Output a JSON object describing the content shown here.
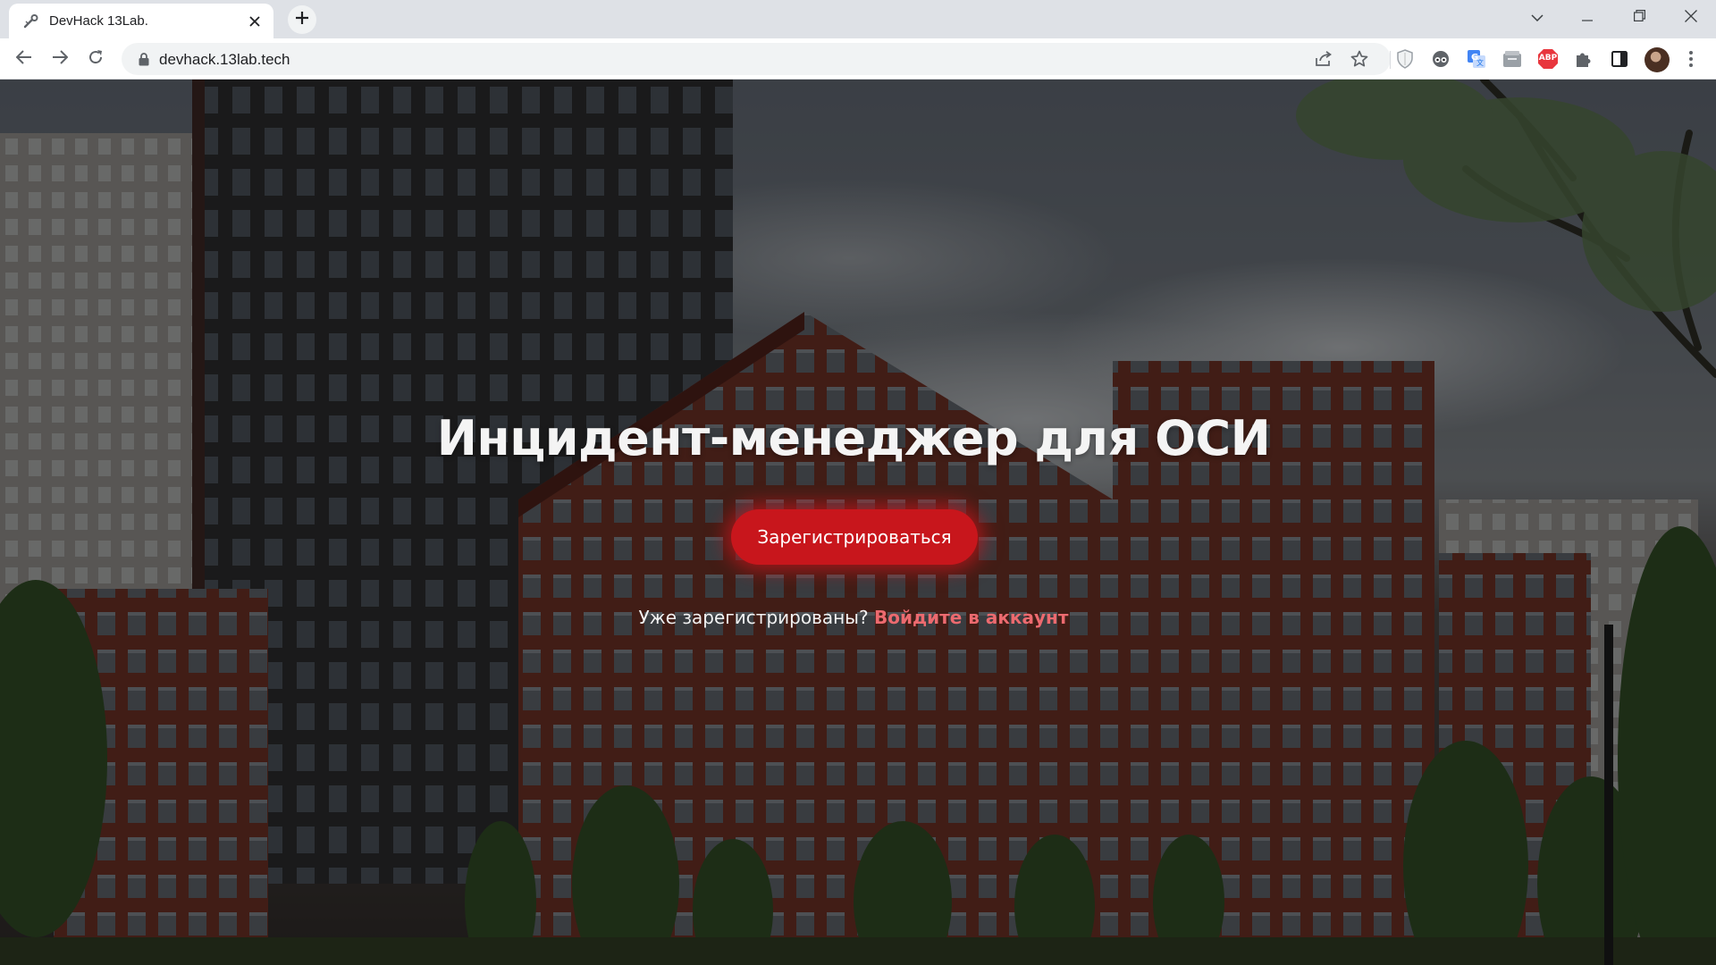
{
  "browser": {
    "tab": {
      "title": "DevHack 13Lab."
    },
    "address_bar": {
      "url": "devhack.13lab.tech"
    },
    "icons": {
      "favicon": "wrench-icon",
      "close": "close-icon",
      "new_tab": "plus-icon",
      "tab_search": "chevron-down-icon",
      "minimize": "minimize-icon",
      "restore": "restore-icon",
      "window_close": "close-icon",
      "back": "arrow-left-icon",
      "forward": "arrow-right-icon",
      "reload": "reload-icon",
      "lock": "lock-icon",
      "share": "share-icon",
      "bookmark": "star-icon",
      "extensions": [
        "shield-extension-icon",
        "tampermonkey-extension-icon",
        "translate-extension-icon",
        "wallet-extension-icon",
        "adblock-extension-icon",
        "puzzle-icon"
      ],
      "side_panel": "side-panel-icon",
      "profile": "avatar",
      "menu": "kebab-menu-icon"
    },
    "adblock_label": "ABP"
  },
  "page": {
    "hero_title": "Инцидент-менеджер для ОСИ",
    "register_button": "Зарегистрироваться",
    "login_prompt": "Уже зарегистрированы?",
    "login_link": "Войдите в аккаунт",
    "colors": {
      "accent": "#c8161c",
      "link": "#ec6a6f"
    }
  }
}
